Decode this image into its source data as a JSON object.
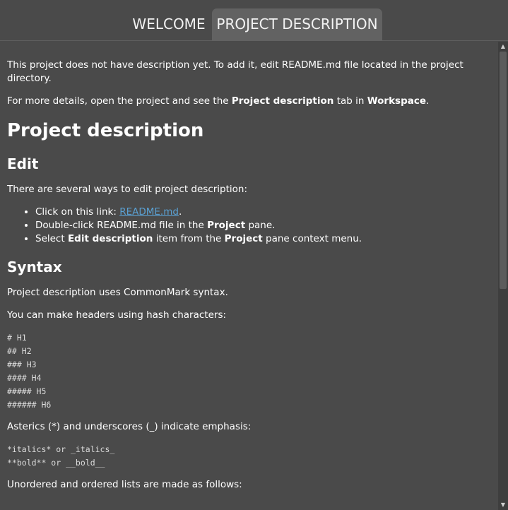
{
  "tabs": [
    {
      "label": "WELCOME",
      "active": false
    },
    {
      "label": "PROJECT DESCRIPTION",
      "active": true
    }
  ],
  "content": {
    "intro1": "This project does not have description yet. To add it, edit README.md file located in the project directory.",
    "intro2_prefix": "For more details, open the project and see the ",
    "intro2_bold1": "Project description",
    "intro2_mid": " tab in ",
    "intro2_bold2": "Workspace",
    "intro2_suffix": ".",
    "h1": "Project description",
    "edit_heading": "Edit",
    "edit_intro": "There are several ways to edit project description:",
    "edit_items": {
      "item1_prefix": "Click on this link: ",
      "item1_link": "README.md",
      "item1_suffix": ".",
      "item2_prefix": "Double-click README.md file in the ",
      "item2_bold": "Project",
      "item2_suffix": " pane.",
      "item3_prefix": "Select ",
      "item3_bold1": "Edit description",
      "item3_mid": " item from the ",
      "item3_bold2": "Project",
      "item3_suffix": " pane context menu."
    },
    "syntax_heading": "Syntax",
    "syntax_p1": "Project description uses CommonMark syntax.",
    "syntax_p2": "You can make headers using hash characters:",
    "headers_code": "# H1\n## H2\n### H3\n#### H4\n##### H5\n###### H6",
    "emphasis_p": "Asterics (*) and underscores (_) indicate emphasis:",
    "emphasis_code": "*italics* or _italics_\n**bold** or __bold__",
    "lists_p": "Unordered and ordered lists are made as follows:"
  },
  "colors": {
    "background": "#4a4a4a",
    "active_tab": "#626262",
    "link": "#5aa0d2"
  },
  "icons": {
    "scroll_up": "▲",
    "scroll_down": "▼"
  }
}
